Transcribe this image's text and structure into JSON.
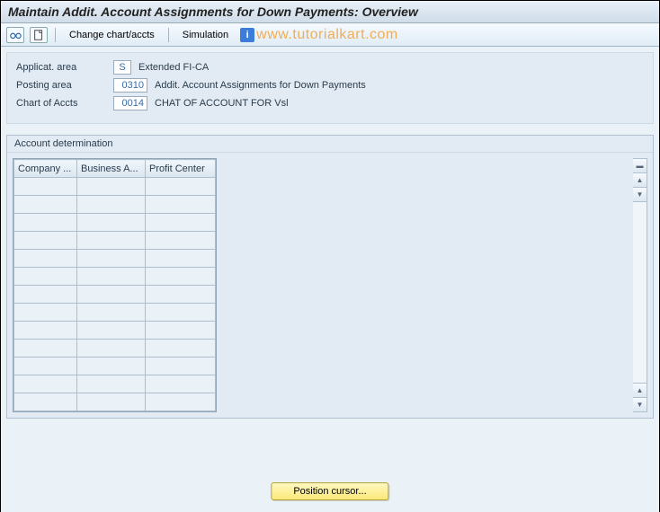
{
  "title": "Maintain Addit. Account Assignments for Down Payments: Overview",
  "toolbar": {
    "change_chart_label": "Change chart/accts",
    "simulation_label": "Simulation"
  },
  "watermark": "www.tutorialkart.com",
  "info": {
    "applicat_area": {
      "label": "Applicat. area",
      "value": "S",
      "desc": "Extended FI-CA"
    },
    "posting_area": {
      "label": "Posting area",
      "value": "0310",
      "desc": "Addit. Account Assignments for Down Payments"
    },
    "chart_of_accts": {
      "label": "Chart of Accts",
      "value": "0014",
      "desc": "CHAT OF ACCOUNT FOR Vsl"
    }
  },
  "acct_panel": {
    "title": "Account determination",
    "columns": [
      "Company ...",
      "Business A...",
      "Profit Center"
    ],
    "rows": [
      [
        "",
        "",
        ""
      ],
      [
        "",
        "",
        ""
      ],
      [
        "",
        "",
        ""
      ],
      [
        "",
        "",
        ""
      ],
      [
        "",
        "",
        ""
      ],
      [
        "",
        "",
        ""
      ],
      [
        "",
        "",
        ""
      ],
      [
        "",
        "",
        ""
      ],
      [
        "",
        "",
        ""
      ],
      [
        "",
        "",
        ""
      ],
      [
        "",
        "",
        ""
      ],
      [
        "",
        "",
        ""
      ],
      [
        "",
        "",
        ""
      ]
    ]
  },
  "position_button": "Position cursor..."
}
